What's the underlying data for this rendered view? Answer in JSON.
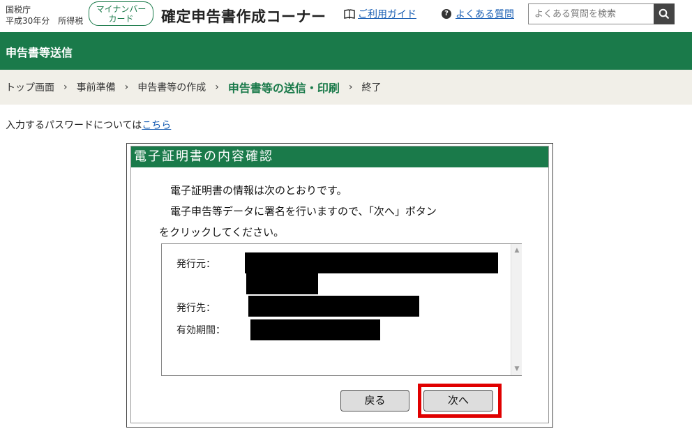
{
  "header": {
    "agency_line1": "国税庁",
    "agency_line2": "平成30年分　所得税",
    "mynumber_line1": "マイナンバー",
    "mynumber_line2": "カード",
    "site_title": "確定申告書作成コーナー",
    "guide_label": "ご利用ガイド",
    "faq_label": "よくある質問",
    "search_placeholder": "よくある質問を検索",
    "accent_color": "#1a7a4a"
  },
  "section_title": "申告書等送信",
  "breadcrumb": {
    "items": [
      "トップ画面",
      "事前準備",
      "申告書等の作成",
      "申告書等の送信・印刷",
      "終了"
    ],
    "current_index": 3
  },
  "note": {
    "text": "入力するパスワードについては",
    "link": "こちら"
  },
  "dialog": {
    "title": "電子証明書の内容確認",
    "line1": "電子証明書の情報は次のとおりです。",
    "line2": "電子申告等データに署名を行いますので、「次へ」ボタン",
    "line3": "をクリックしてください。",
    "fields": {
      "issuer_label": "発行元：",
      "subject_label": "発行先：",
      "validity_label": "有効期間："
    },
    "back_label": "戻る",
    "next_label": "次へ"
  }
}
